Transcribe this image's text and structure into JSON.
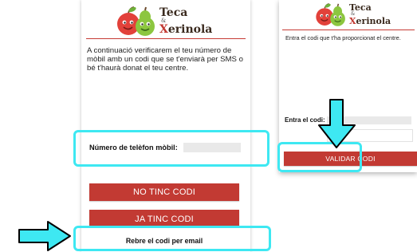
{
  "left_screen": {
    "logo": {
      "word1": "Teca",
      "amp": "&",
      "word2_first": "X",
      "word2_rest": "erinola"
    },
    "intro_text": "A continuació verificarem el teu número de mòbil amb un codi que se t'enviarà per SMS o bé t'haurà donat el teu centre.",
    "phone_label": "Número de telèfon mòbil:",
    "phone_value": "",
    "no_code_button": "NO TINC CODI",
    "have_code_button": "JA TINC CODI",
    "email_link": "Rebre el codi per email"
  },
  "right_screen": {
    "logo": {
      "word1": "Teca",
      "amp": "&",
      "word2_first": "X",
      "word2_rest": "erinola"
    },
    "intro_text": "Entra el codi que t'ha proporcionat el centre.",
    "code_label": "Entra el codi:",
    "code_value": "",
    "validate_button": "VALIDAR CODI"
  },
  "colors": {
    "brand_red": "#c23a33",
    "annotation_cyan": "#3ee8f2",
    "logo_apple": "#e2413a",
    "logo_pear": "#8cc63f"
  }
}
